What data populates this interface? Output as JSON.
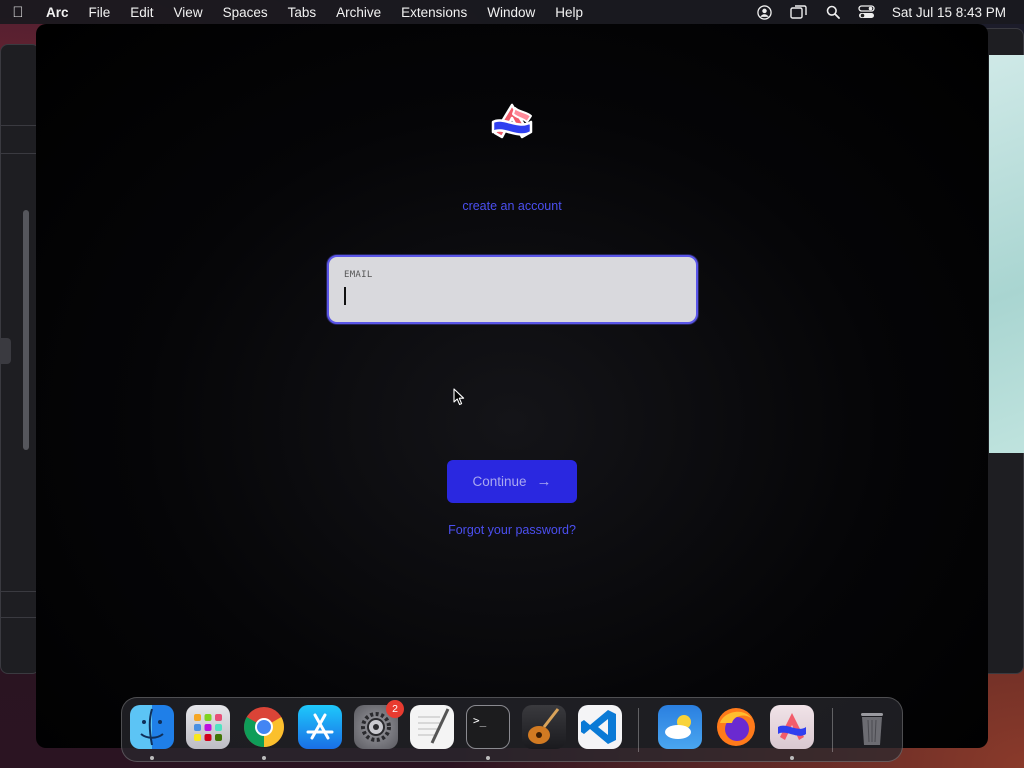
{
  "menubar": {
    "app_name": "Arc",
    "items": [
      "File",
      "Edit",
      "View",
      "Spaces",
      "Tabs",
      "Archive",
      "Extensions",
      "Window",
      "Help"
    ],
    "status_icons": [
      "user-account-icon",
      "screen-mirroring-icon",
      "spotlight-search-icon",
      "control-center-icon"
    ],
    "clock": "Sat Jul 15  8:43 PM"
  },
  "login": {
    "create_account_link": "create an account",
    "email_label": "EMAIL",
    "email_value": "",
    "continue_label": "Continue",
    "continue_arrow": "→",
    "forgot_link": "Forgot your password?"
  },
  "dock": {
    "apps": [
      {
        "name": "Finder",
        "icon": "finder-icon",
        "running": true
      },
      {
        "name": "Launchpad",
        "icon": "launchpad-icon",
        "running": false
      },
      {
        "name": "Google Chrome",
        "icon": "chrome-icon",
        "running": true
      },
      {
        "name": "App Store",
        "icon": "app-store-icon",
        "running": false
      },
      {
        "name": "System Settings",
        "icon": "settings-gear-icon",
        "running": false,
        "badge": "2"
      },
      {
        "name": "TextEdit",
        "icon": "textedit-icon",
        "running": false
      },
      {
        "name": "Terminal",
        "icon": "terminal-icon",
        "running": true
      },
      {
        "name": "GarageBand",
        "icon": "garageband-guitar-icon",
        "running": false
      },
      {
        "name": "Visual Studio Code",
        "icon": "vscode-icon",
        "running": false
      },
      {
        "name": "Weather",
        "icon": "weather-icon",
        "running": false
      },
      {
        "name": "Firefox",
        "icon": "firefox-icon",
        "running": false
      },
      {
        "name": "Arc",
        "icon": "arc-icon",
        "running": true
      },
      {
        "name": "Trash",
        "icon": "trash-icon",
        "running": false
      }
    ]
  },
  "colors": {
    "accent": "#2a28e0",
    "link": "#4b4ff0",
    "input_border": "#5a56e8"
  }
}
